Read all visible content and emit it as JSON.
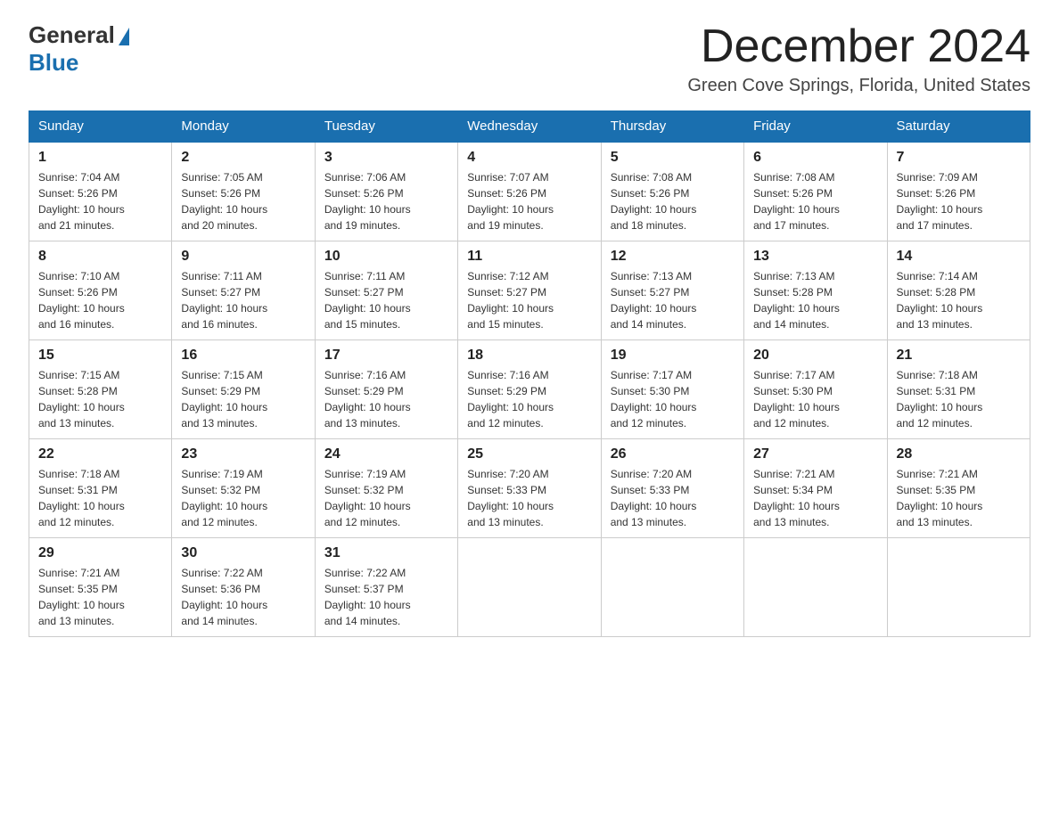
{
  "logo": {
    "general": "General",
    "blue": "Blue"
  },
  "header": {
    "month": "December 2024",
    "location": "Green Cove Springs, Florida, United States"
  },
  "days_of_week": [
    "Sunday",
    "Monday",
    "Tuesday",
    "Wednesday",
    "Thursday",
    "Friday",
    "Saturday"
  ],
  "weeks": [
    [
      {
        "num": "1",
        "sunrise": "7:04 AM",
        "sunset": "5:26 PM",
        "daylight": "10 hours and 21 minutes."
      },
      {
        "num": "2",
        "sunrise": "7:05 AM",
        "sunset": "5:26 PM",
        "daylight": "10 hours and 20 minutes."
      },
      {
        "num": "3",
        "sunrise": "7:06 AM",
        "sunset": "5:26 PM",
        "daylight": "10 hours and 19 minutes."
      },
      {
        "num": "4",
        "sunrise": "7:07 AM",
        "sunset": "5:26 PM",
        "daylight": "10 hours and 19 minutes."
      },
      {
        "num": "5",
        "sunrise": "7:08 AM",
        "sunset": "5:26 PM",
        "daylight": "10 hours and 18 minutes."
      },
      {
        "num": "6",
        "sunrise": "7:08 AM",
        "sunset": "5:26 PM",
        "daylight": "10 hours and 17 minutes."
      },
      {
        "num": "7",
        "sunrise": "7:09 AM",
        "sunset": "5:26 PM",
        "daylight": "10 hours and 17 minutes."
      }
    ],
    [
      {
        "num": "8",
        "sunrise": "7:10 AM",
        "sunset": "5:26 PM",
        "daylight": "10 hours and 16 minutes."
      },
      {
        "num": "9",
        "sunrise": "7:11 AM",
        "sunset": "5:27 PM",
        "daylight": "10 hours and 16 minutes."
      },
      {
        "num": "10",
        "sunrise": "7:11 AM",
        "sunset": "5:27 PM",
        "daylight": "10 hours and 15 minutes."
      },
      {
        "num": "11",
        "sunrise": "7:12 AM",
        "sunset": "5:27 PM",
        "daylight": "10 hours and 15 minutes."
      },
      {
        "num": "12",
        "sunrise": "7:13 AM",
        "sunset": "5:27 PM",
        "daylight": "10 hours and 14 minutes."
      },
      {
        "num": "13",
        "sunrise": "7:13 AM",
        "sunset": "5:28 PM",
        "daylight": "10 hours and 14 minutes."
      },
      {
        "num": "14",
        "sunrise": "7:14 AM",
        "sunset": "5:28 PM",
        "daylight": "10 hours and 13 minutes."
      }
    ],
    [
      {
        "num": "15",
        "sunrise": "7:15 AM",
        "sunset": "5:28 PM",
        "daylight": "10 hours and 13 minutes."
      },
      {
        "num": "16",
        "sunrise": "7:15 AM",
        "sunset": "5:29 PM",
        "daylight": "10 hours and 13 minutes."
      },
      {
        "num": "17",
        "sunrise": "7:16 AM",
        "sunset": "5:29 PM",
        "daylight": "10 hours and 13 minutes."
      },
      {
        "num": "18",
        "sunrise": "7:16 AM",
        "sunset": "5:29 PM",
        "daylight": "10 hours and 12 minutes."
      },
      {
        "num": "19",
        "sunrise": "7:17 AM",
        "sunset": "5:30 PM",
        "daylight": "10 hours and 12 minutes."
      },
      {
        "num": "20",
        "sunrise": "7:17 AM",
        "sunset": "5:30 PM",
        "daylight": "10 hours and 12 minutes."
      },
      {
        "num": "21",
        "sunrise": "7:18 AM",
        "sunset": "5:31 PM",
        "daylight": "10 hours and 12 minutes."
      }
    ],
    [
      {
        "num": "22",
        "sunrise": "7:18 AM",
        "sunset": "5:31 PM",
        "daylight": "10 hours and 12 minutes."
      },
      {
        "num": "23",
        "sunrise": "7:19 AM",
        "sunset": "5:32 PM",
        "daylight": "10 hours and 12 minutes."
      },
      {
        "num": "24",
        "sunrise": "7:19 AM",
        "sunset": "5:32 PM",
        "daylight": "10 hours and 12 minutes."
      },
      {
        "num": "25",
        "sunrise": "7:20 AM",
        "sunset": "5:33 PM",
        "daylight": "10 hours and 13 minutes."
      },
      {
        "num": "26",
        "sunrise": "7:20 AM",
        "sunset": "5:33 PM",
        "daylight": "10 hours and 13 minutes."
      },
      {
        "num": "27",
        "sunrise": "7:21 AM",
        "sunset": "5:34 PM",
        "daylight": "10 hours and 13 minutes."
      },
      {
        "num": "28",
        "sunrise": "7:21 AM",
        "sunset": "5:35 PM",
        "daylight": "10 hours and 13 minutes."
      }
    ],
    [
      {
        "num": "29",
        "sunrise": "7:21 AM",
        "sunset": "5:35 PM",
        "daylight": "10 hours and 13 minutes."
      },
      {
        "num": "30",
        "sunrise": "7:22 AM",
        "sunset": "5:36 PM",
        "daylight": "10 hours and 14 minutes."
      },
      {
        "num": "31",
        "sunrise": "7:22 AM",
        "sunset": "5:37 PM",
        "daylight": "10 hours and 14 minutes."
      },
      null,
      null,
      null,
      null
    ]
  ],
  "labels": {
    "sunrise": "Sunrise:",
    "sunset": "Sunset:",
    "daylight": "Daylight:"
  }
}
